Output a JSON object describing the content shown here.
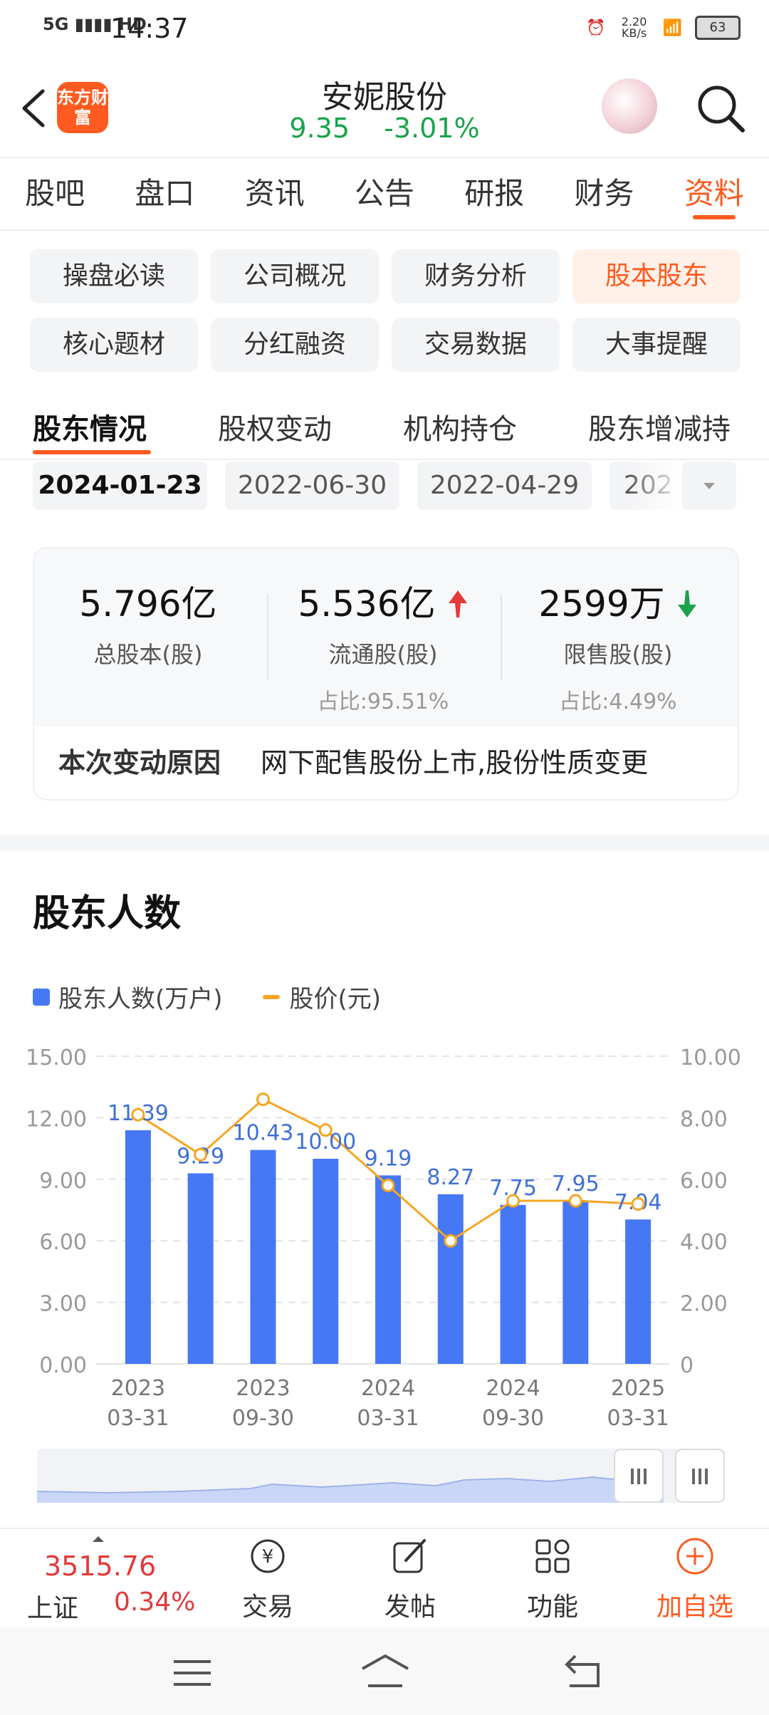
{
  "status": {
    "network": "5G",
    "hd": "HD",
    "time": "14:37",
    "speed": "2.20 KB/s",
    "battery": "63"
  },
  "header": {
    "logo": "东方财富",
    "name": "安妮股份",
    "price": "9.35",
    "change": "-3.01%"
  },
  "tabs": [
    "股吧",
    "盘口",
    "资讯",
    "公告",
    "研报",
    "财务",
    "资料"
  ],
  "active_tab": "资料",
  "chips": [
    "操盘必读",
    "公司概况",
    "财务分析",
    "股本股东",
    "核心题材",
    "分红融资",
    "交易数据",
    "大事提醒"
  ],
  "active_chip": "股本股东",
  "subtabs": [
    "股东情况",
    "股权变动",
    "机构持仓",
    "股东增减持"
  ],
  "dates": [
    "2024-01-23",
    "2022-06-30",
    "2022-04-29",
    "202"
  ],
  "stats": {
    "total": {
      "value": "5.796亿",
      "label": "总股本(股)"
    },
    "float": {
      "value": "5.536亿",
      "label": "流通股(股)",
      "ratio": "占比:95.51%"
    },
    "restricted": {
      "value": "2599万",
      "label": "限售股(股)",
      "ratio": "占比:4.49%"
    }
  },
  "reason": {
    "title": "本次变动原因",
    "text": "网下配售股份上市,股份性质变更"
  },
  "section_title": "股东人数",
  "legend": {
    "bar": "股东人数(万户)",
    "line": "股价(元)"
  },
  "chart_data": {
    "type": "bar",
    "x": [
      "2023-03-31",
      "2023-06-30",
      "2023-09-30",
      "2023-12-31",
      "2024-03-31",
      "2024-06-30",
      "2024-09-30",
      "2024-12-31",
      "2025-03-31"
    ],
    "series": [
      {
        "name": "股东人数(万户)",
        "type": "bar",
        "values": [
          11.39,
          9.29,
          10.43,
          10.0,
          9.19,
          8.27,
          7.75,
          7.95,
          7.04
        ],
        "labels": [
          "11.39",
          "9.29",
          "10.43",
          "10.00",
          "9.19",
          "8.27",
          "7.75",
          "7.95",
          "7.04"
        ]
      },
      {
        "name": "股价(元)",
        "type": "line",
        "values": [
          8.1,
          6.8,
          8.6,
          7.6,
          5.8,
          4.0,
          5.3,
          5.3,
          5.2
        ]
      }
    ],
    "x_tick_labels": [
      [
        "2023",
        "03-31"
      ],
      [
        "2023",
        "09-30"
      ],
      [
        "2024",
        "03-31"
      ],
      [
        "2024",
        "09-30"
      ],
      [
        "2025",
        "03-31"
      ]
    ],
    "y_left_ticks": [
      "15.00",
      "12.00",
      "9.00",
      "6.00",
      "3.00",
      "0.00"
    ],
    "y_right_ticks": [
      "10.00",
      "8.00",
      "6.00",
      "4.00",
      "2.00",
      "0"
    ],
    "ylim_left": [
      0,
      15
    ],
    "ylim_right": [
      0,
      10
    ],
    "colors": {
      "bar": "#4677f5",
      "line": "#f5a623"
    },
    "grid": true
  },
  "bottombar": {
    "index_value": "3515.76",
    "index_name": "上证",
    "index_pct": "0.34%",
    "items": [
      "交易",
      "发帖",
      "功能",
      "加自选"
    ]
  }
}
